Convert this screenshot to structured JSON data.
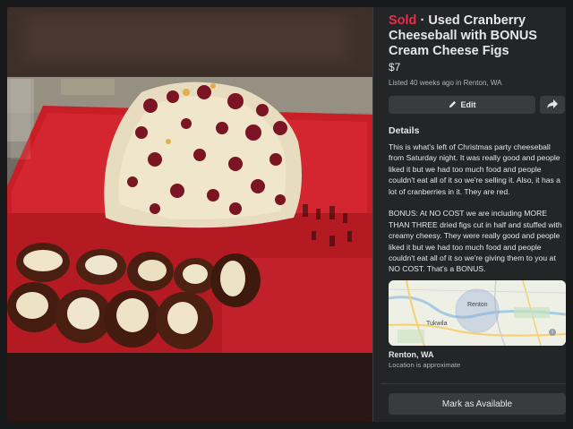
{
  "listing": {
    "status": "Sold",
    "separator": " · ",
    "title": "Used Cranberry Cheeseball with BONUS Cream Cheese Figs",
    "price": "$7",
    "listed": "Listed 40 weeks ago in Renton, WA"
  },
  "actions": {
    "edit_label": "Edit",
    "mark_available_label": "Mark as Available"
  },
  "details": {
    "heading": "Details",
    "paragraphs": [
      "This is what's left of Christmas party cheeseball from Saturday night. It was really good and people liked it but we had too much food and people couldn't eat all of it so we're selling it. Also, it has a lot of cranberries in it. They are red.",
      "BONUS: At NO COST we are including MORE THAN THREE dried figs cut in half and stuffed with creamy cheesy. They were really good and people liked it but we had too much food and people couldn't eat all of it so we're giving them to you at NO COST. That's a BONUS."
    ]
  },
  "map": {
    "labels": [
      "Renton",
      "Tukwila"
    ]
  },
  "location": {
    "name": "Renton, WA",
    "note": "Location is approximate"
  },
  "colors": {
    "sold": "#f02849",
    "panel_bg": "#242526",
    "button_bg": "#3a3b3c"
  },
  "icons": [
    "pencil-icon",
    "share-arrow-icon",
    "info-icon"
  ]
}
